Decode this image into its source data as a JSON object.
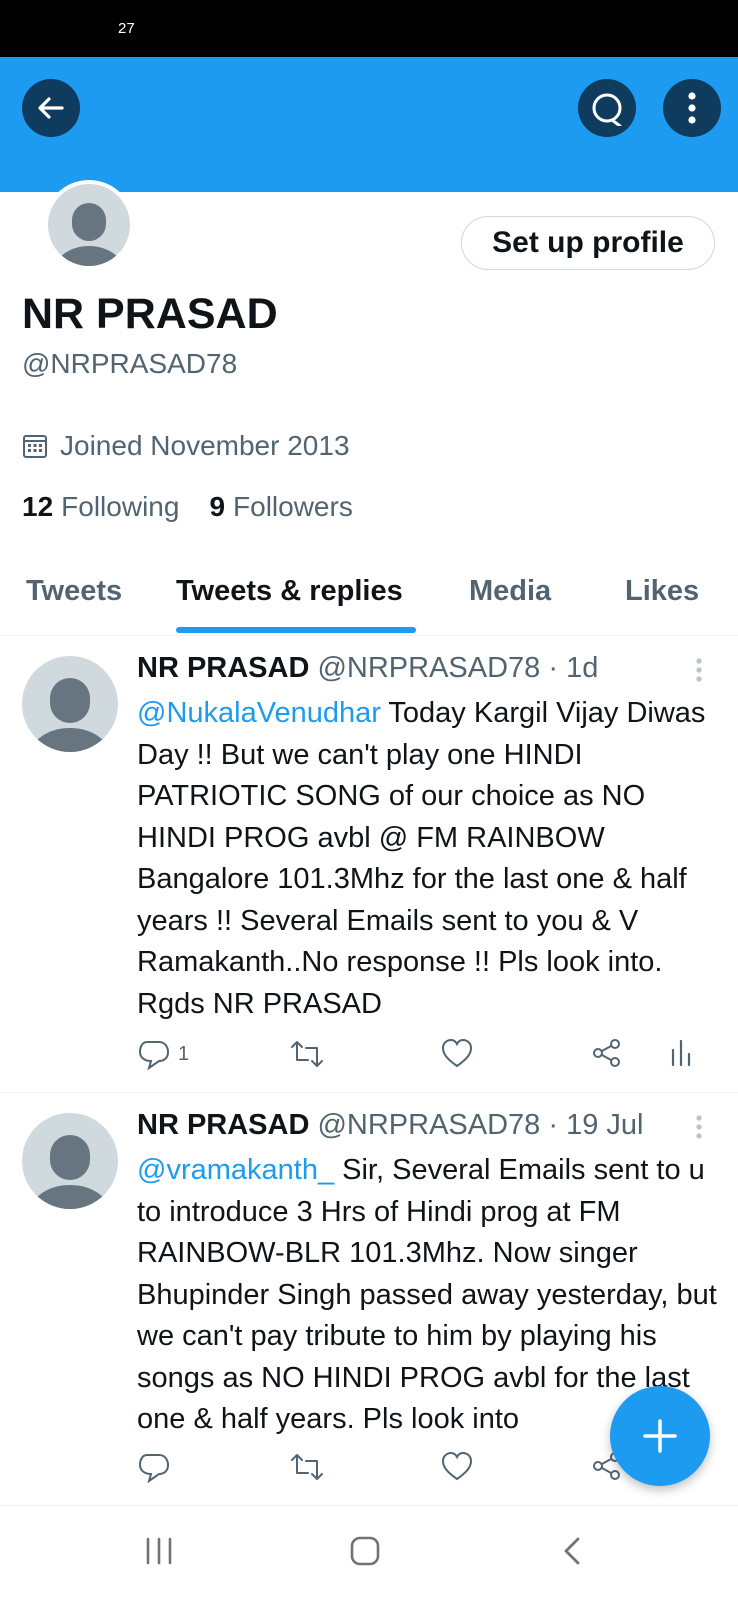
{
  "status_bar": {
    "time": "27"
  },
  "colors": {
    "accent": "#1d9bf0",
    "banner": "#1d9bf0",
    "icon_button_bg": "#0f3b5e"
  },
  "profile": {
    "setup_button_label": "Set up profile",
    "display_name": "NR PRASAD",
    "handle": "@NRPRASAD78",
    "joined": "Joined November 2013",
    "following_count": "12",
    "following_label": "Following",
    "followers_count": "9",
    "followers_label": "Followers"
  },
  "tabs": [
    {
      "label": "Tweets",
      "active": false
    },
    {
      "label": "Tweets & replies",
      "active": true
    },
    {
      "label": "Media",
      "active": false
    },
    {
      "label": "Likes",
      "active": false
    }
  ],
  "tweets": [
    {
      "name": "NR PRASAD",
      "handle": "@NRPRASAD78",
      "time": "· 1d",
      "mention": "@NukalaVenudhar",
      "text": " Today Kargil Vijay Diwas Day !! But we can't play one HINDI PATRIOTIC SONG of our choice as NO HINDI PROG avbl @ FM RAINBOW Bangalore 101.3Mhz for the last one & half years !! Several Emails sent to you & V Ramakanth..No response !! Pls look into. Rgds NR PRASAD",
      "reply_count": "1"
    },
    {
      "name": "NR PRASAD",
      "handle": "@NRPRASAD78",
      "time": "· 19 Jul",
      "mention": "@vramakanth_",
      "text": " Sir, Several Emails sent to u to introduce 3 Hrs of Hindi prog at FM RAINBOW-BLR 101.3Mhz. Now singer Bhupinder Singh passed away yesterday, but we can't pay tribute to him by playing his songs as NO HINDI PROG avbl for the last one & half years. Pls look into",
      "reply_count": ""
    }
  ],
  "icons": {
    "back": "arrow-left-icon",
    "search": "search-icon",
    "more": "more-vertical-icon",
    "calendar": "calendar-icon",
    "reply": "reply-icon",
    "retweet": "retweet-icon",
    "like": "heart-icon",
    "share": "share-icon",
    "analytics": "analytics-icon",
    "compose": "plus-icon"
  }
}
